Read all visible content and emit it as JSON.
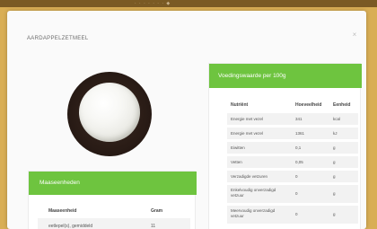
{
  "topbar": {
    "text": "· · · · · ·   ·   ◆"
  },
  "modal": {
    "title": "AARDAPPELZETMEEL",
    "close_label": "×"
  },
  "left_card": {
    "header": "Maaseenheden",
    "columns": [
      "Maaseenheid",
      "Gram"
    ],
    "rows": [
      [
        "eetlepel(s), gemiddeld",
        "11"
      ]
    ]
  },
  "right_card": {
    "header": "Voedingswaarde per 100g",
    "columns": [
      "Nutriënt",
      "Hoeveelheid",
      "Eenheid"
    ],
    "rows": [
      [
        "Energie met vezel",
        "341",
        "kcal"
      ],
      [
        "Energie met vezel",
        "1361",
        "kJ"
      ],
      [
        "Eiwitten",
        "0,1",
        "g"
      ],
      [
        "Vetten",
        "0,05",
        "g"
      ],
      [
        "Verzadigde vetzuren",
        "0",
        "g"
      ],
      [
        "Enkelvoudig onverzadigd vetzuur",
        "0",
        "g"
      ],
      [
        "Meervoudig onverzadigd vetzuur",
        "0",
        "g"
      ]
    ]
  },
  "colors": {
    "accent_green": "#6ec43f",
    "background_gold": "#d9ae55"
  }
}
